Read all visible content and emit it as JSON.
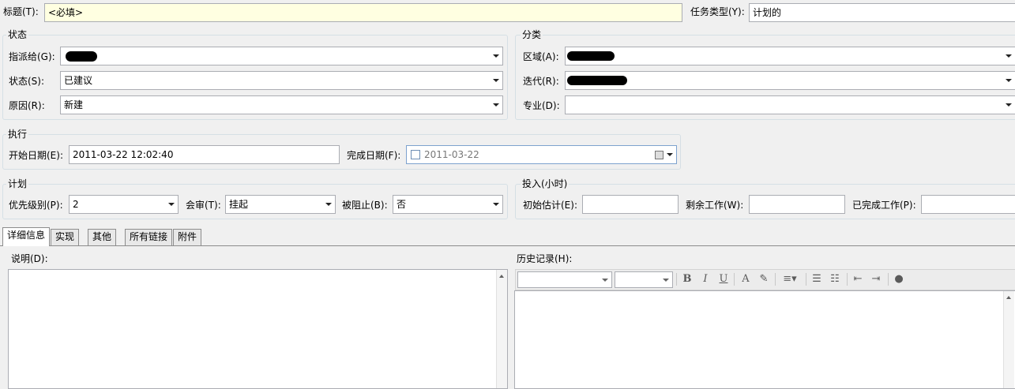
{
  "header": {
    "title_label": "标题(T):",
    "title_value": "<必填>",
    "task_type_label": "任务类型(Y):",
    "task_type_value": "计划的"
  },
  "status": {
    "group_title": "状态",
    "assigned_label": "指派给(G):",
    "assigned_value": "",
    "state_label": "状态(S):",
    "state_value": "已建议",
    "reason_label": "原因(R):",
    "reason_value": "新建"
  },
  "classification": {
    "group_title": "分类",
    "area_label": "区域(A):",
    "area_value": "",
    "iteration_label": "迭代(R):",
    "iteration_value": "",
    "discipline_label": "专业(D):",
    "discipline_value": ""
  },
  "execution": {
    "group_title": "执行",
    "start_label": "开始日期(E):",
    "start_value": "2011-03-22 12:02:40",
    "finish_label": "完成日期(F):",
    "finish_value": "2011-03-22"
  },
  "plan": {
    "group_title": "计划",
    "priority_label": "优先级别(P):",
    "priority_value": "2",
    "review_label": "会审(T):",
    "review_value": "挂起",
    "blocked_label": "被阻止(B):",
    "blocked_value": "否"
  },
  "effort": {
    "group_title": "投入(小时)",
    "original_label": "初始估计(E):",
    "original_value": "",
    "remaining_label": "剩余工作(W):",
    "remaining_value": "",
    "completed_label": "已完成工作(P):",
    "completed_value": ""
  },
  "tabs": [
    {
      "label": "详细信息",
      "active": true
    },
    {
      "label": "实现",
      "active": false
    },
    {
      "label": "其他",
      "active": false
    },
    {
      "label": "所有链接",
      "active": false
    },
    {
      "label": "附件",
      "active": false
    }
  ],
  "details": {
    "description_label": "说明(D):",
    "history_label": "历史记录(H):",
    "font_name_value": "",
    "font_size_value": ""
  },
  "toolbar_icons": [
    "bold-icon",
    "italic-icon",
    "underline-icon",
    "font-color-icon",
    "highlight-icon",
    "align-icon",
    "bullet-list-icon",
    "numbered-list-icon",
    "decrease-indent-icon",
    "increase-indent-icon",
    "hyperlink-icon"
  ]
}
